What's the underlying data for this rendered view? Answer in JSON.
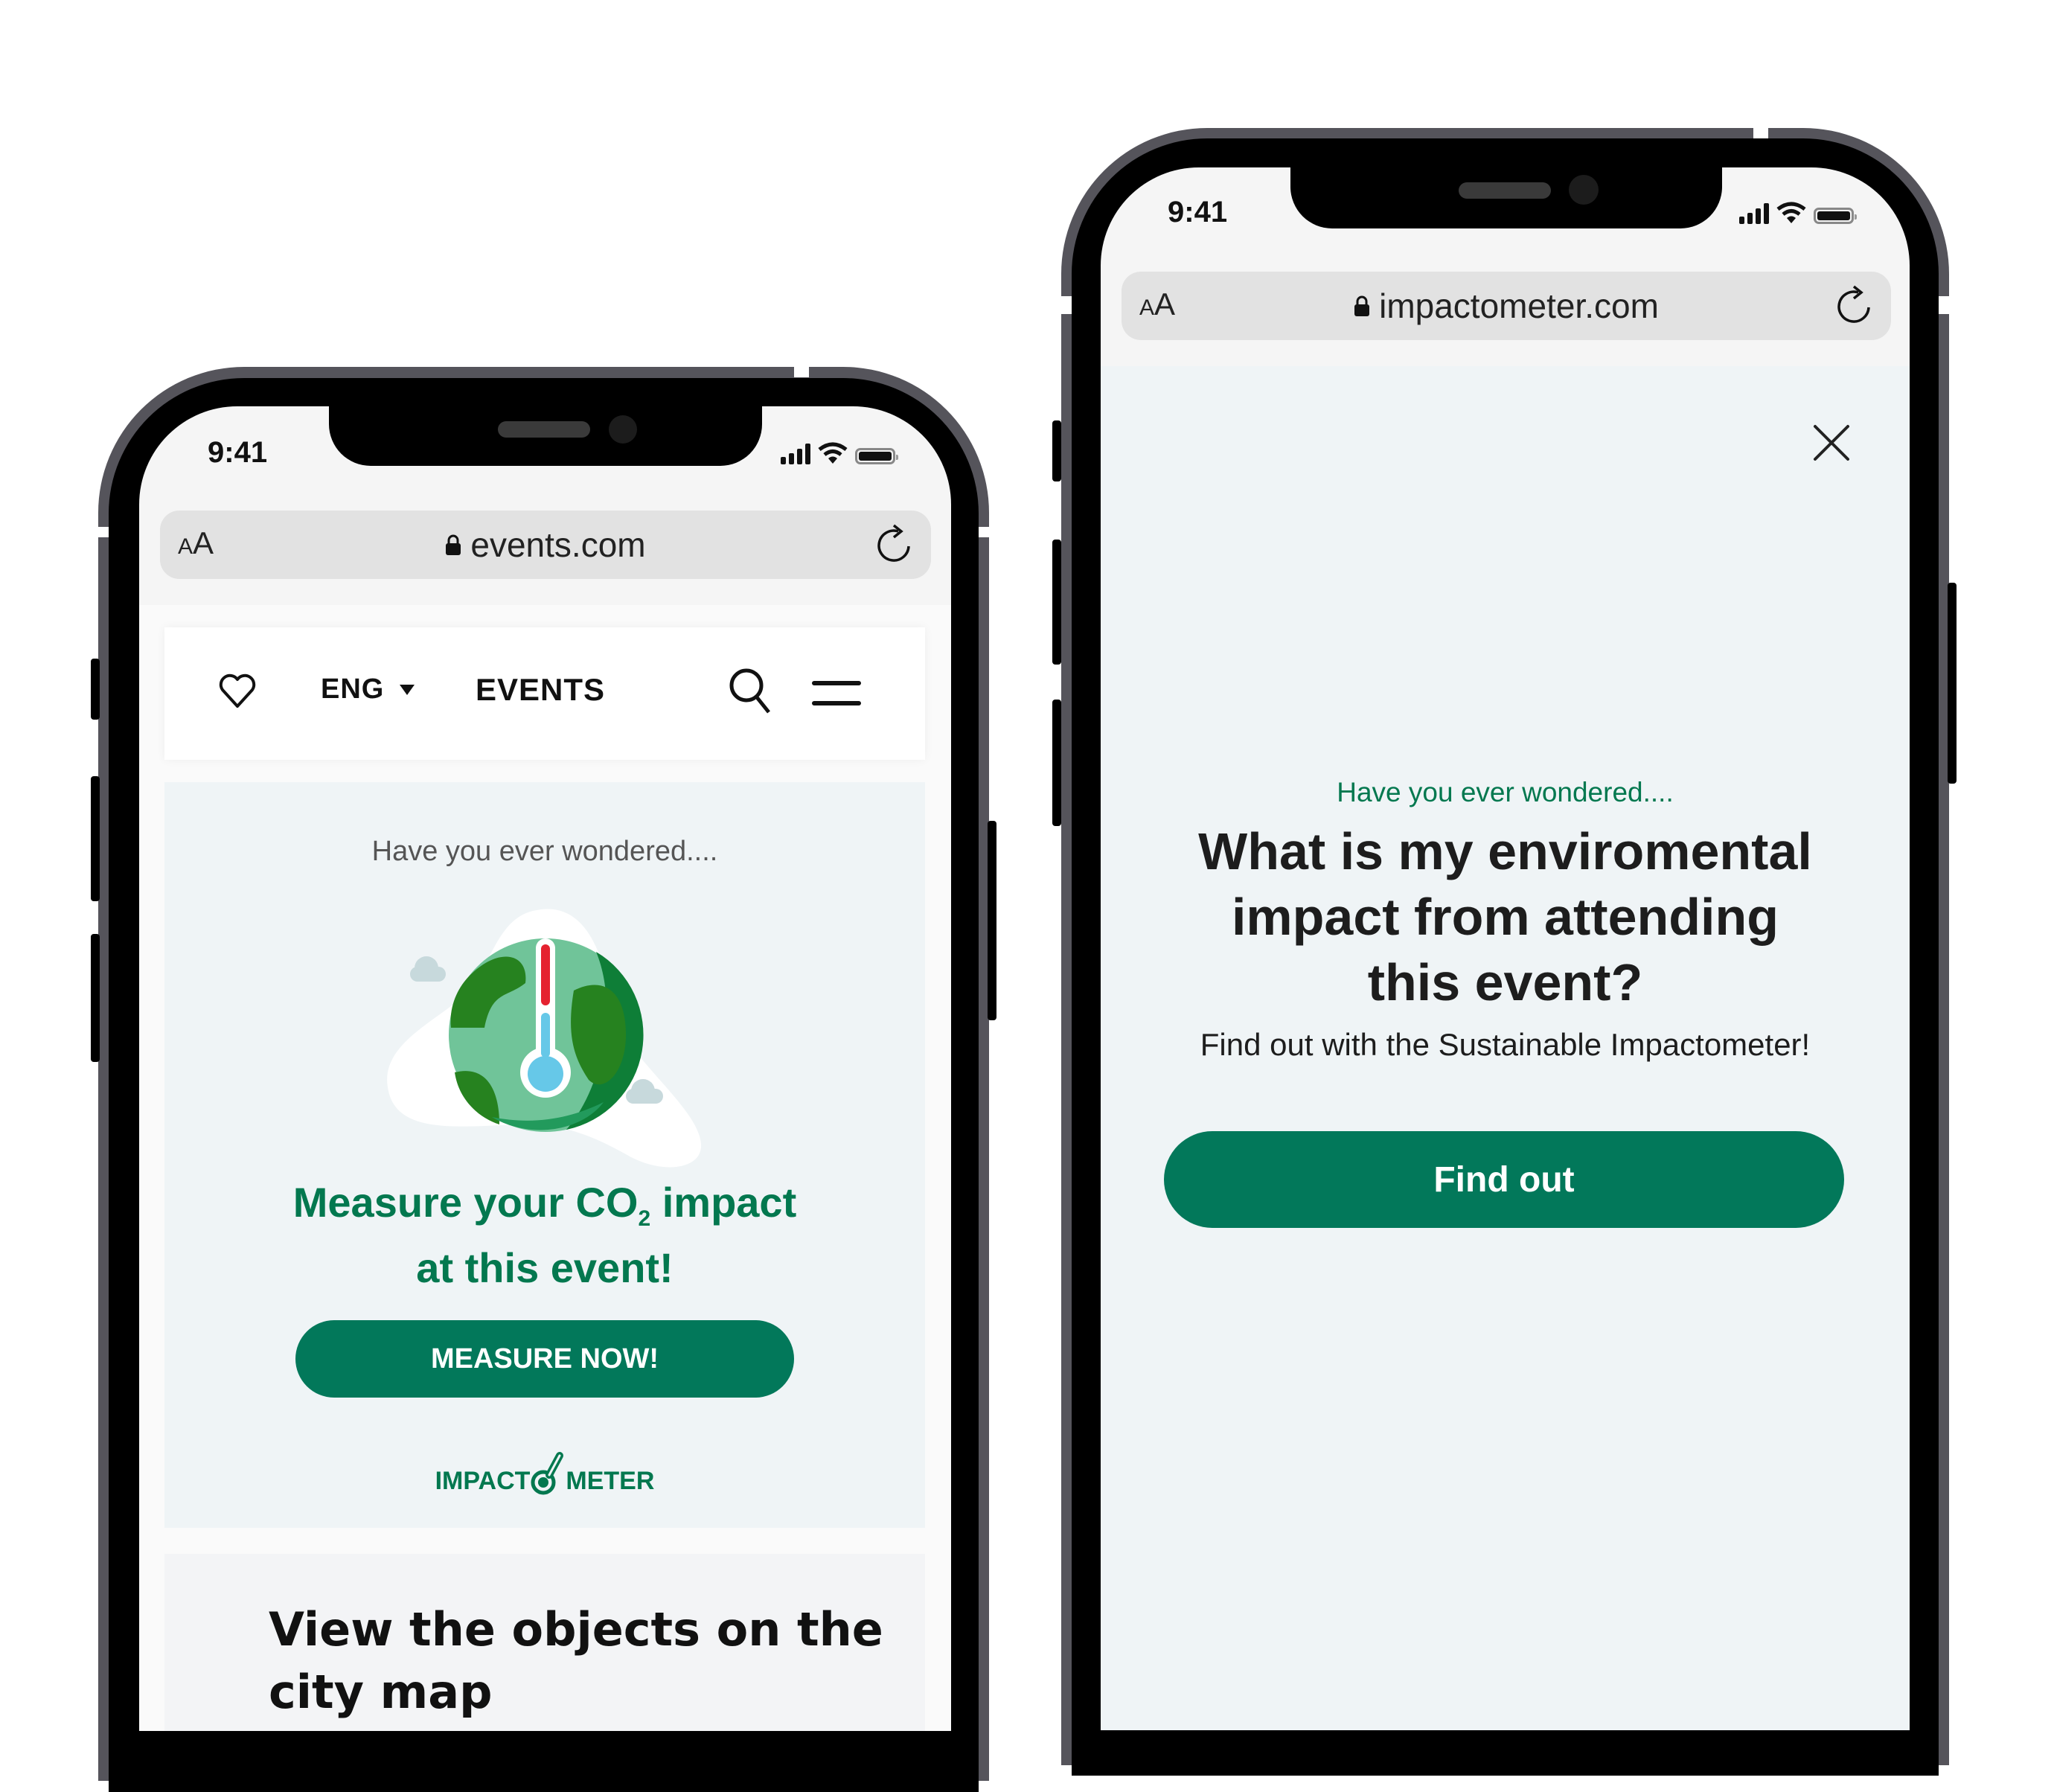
{
  "left_phone": {
    "status_bar": {
      "time": "9:41"
    },
    "browser": {
      "text_size_small": "A",
      "text_size_large": "A",
      "url": "events.com"
    },
    "nav": {
      "language": "ENG",
      "section": "EVENTS"
    },
    "hero": {
      "eyebrow": "Have you ever wondered....",
      "headline_part1": "Measure your CO",
      "headline_sub": "2",
      "headline_part2": " impact",
      "headline_line2": "at this event!",
      "cta_label": "MEASURE NOW!",
      "logo_left": "IMPACT",
      "logo_right": "METER"
    },
    "map_card": {
      "title_line1": "View the objects on the",
      "title_line2": "city map"
    }
  },
  "right_phone": {
    "status_bar": {
      "time": "9:41"
    },
    "browser": {
      "text_size_small": "A",
      "text_size_large": "A",
      "url": "impactometer.com"
    },
    "modal": {
      "eyebrow": "Have you ever wondered....",
      "title_line1": "What is my enviromental",
      "title_line2": "impact from attending",
      "title_line3": "this event?",
      "subtitle": "Find out with the Sustainable Impactometer!",
      "cta_label": "Find out"
    }
  },
  "colors": {
    "brand_green": "#02785a",
    "hero_bg": "#eff4f6",
    "frame": "#55545b"
  }
}
